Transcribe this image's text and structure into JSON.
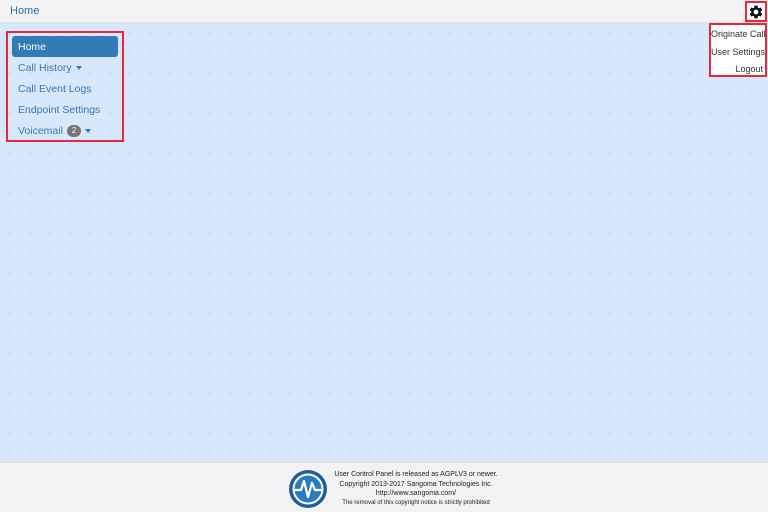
{
  "header": {
    "breadcrumb_home": "Home",
    "settings_icon": "gear-icon"
  },
  "sidebar": {
    "items": [
      {
        "label": "Home",
        "active": true
      },
      {
        "label": "Call History",
        "has_caret": true
      },
      {
        "label": "Call Event Logs"
      },
      {
        "label": "Endpoint Settings"
      },
      {
        "label": "Voicemail",
        "badge": "2",
        "has_caret": true
      }
    ]
  },
  "dropdown": {
    "items": [
      {
        "label": "Originate Call"
      },
      {
        "label": "User Settings"
      },
      {
        "label": "Logout"
      }
    ]
  },
  "footer": {
    "line1": "User Control Panel is released as AGPLV3 or newer.",
    "line2": "Copyright 2013-2017 Sangoma Technologies Inc.",
    "line3": "http://www.sangoma.com/",
    "line4": "The removal of this copyright notice is strictly prohibited",
    "logo_icon": "sangoma-logo-icon"
  },
  "colors": {
    "accent": "#337ab7",
    "highlight_border": "#e8283a",
    "main_background": "#d7e8fb",
    "badge": "#777777"
  }
}
